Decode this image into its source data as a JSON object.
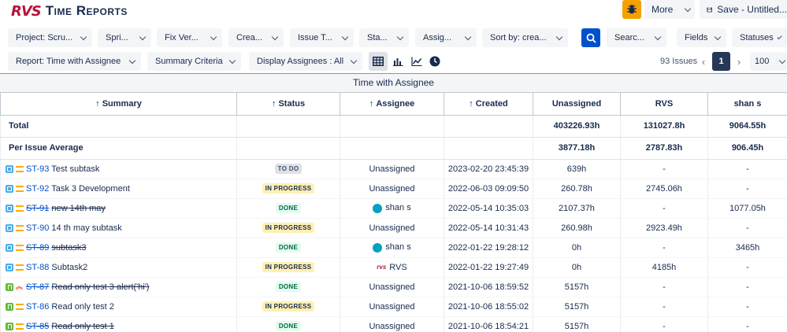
{
  "app": {
    "logo_mark": "RVS",
    "title": "Time Reports"
  },
  "header": {
    "more_label": "More",
    "save_label": "Save - Untitled...",
    "bug_icon": "bug-icon"
  },
  "filters_row1": {
    "project": "Project: Scru...",
    "sprint": "Spri...",
    "fix_version": "Fix Ver...",
    "created": "Crea...",
    "issue_type": "Issue T...",
    "status": "Sta...",
    "assignee": "Assig...",
    "sort_by": "Sort by: crea...",
    "search": "Searc...",
    "fields": "Fields",
    "statuses": "Statuses"
  },
  "filters_row2": {
    "report": "Report: Time with Assignee",
    "summary_criteria": "Summary Criteria",
    "display_assignees": "Display Assignees : All"
  },
  "pagination": {
    "issues_count": "93 Issues",
    "prev": "‹",
    "current_page": "1",
    "next": "›",
    "page_size": "100"
  },
  "report": {
    "title": "Time with Assignee",
    "columns": [
      "Summary",
      "Status",
      "Assignee",
      "Created",
      "Unassigned",
      "RVS",
      "shan s"
    ],
    "total": {
      "label": "Total",
      "unassigned": "403226.93h",
      "rvs": "131027.8h",
      "shan": "9064.55h"
    },
    "average": {
      "label": "Per Issue Average",
      "unassigned": "3877.18h",
      "rvs": "2787.83h",
      "shan": "906.45h"
    },
    "rows": [
      {
        "key": "ST-93",
        "summary": "Test subtask",
        "status": "TO DO",
        "assignee": "Unassigned",
        "created": "2023-02-20 23:45:39",
        "unassigned": "639h",
        "rvs": "-",
        "shan": "-"
      },
      {
        "key": "ST-92",
        "summary": "Task 3 Development",
        "status": "IN PROGRESS",
        "assignee": "Unassigned",
        "created": "2022-06-03 09:09:50",
        "unassigned": "260.78h",
        "rvs": "2745.06h",
        "shan": "-"
      },
      {
        "key": "ST-91",
        "summary": "new 14th may",
        "status": "DONE",
        "assignee": "shan s",
        "created": "2022-05-14 10:35:03",
        "unassigned": "2107.37h",
        "rvs": "-",
        "shan": "1077.05h"
      },
      {
        "key": "ST-90",
        "summary": "14 th may subtask",
        "status": "IN PROGRESS",
        "assignee": "Unassigned",
        "created": "2022-05-14 10:31:43",
        "unassigned": "260.98h",
        "rvs": "2923.49h",
        "shan": "-"
      },
      {
        "key": "ST-89",
        "summary": "subtask3",
        "status": "DONE",
        "assignee": "shan s",
        "created": "2022-01-22 19:28:12",
        "unassigned": "0h",
        "rvs": "-",
        "shan": "3465h"
      },
      {
        "key": "ST-88",
        "summary": "Subtask2",
        "status": "IN PROGRESS",
        "assignee": "RVS",
        "created": "2022-01-22 19:27:49",
        "unassigned": "0h",
        "rvs": "4185h",
        "shan": "-"
      },
      {
        "key": "ST-87",
        "summary": "Read only test 3 alert('hi')",
        "status": "DONE",
        "assignee": "Unassigned",
        "created": "2021-10-06 18:59:52",
        "unassigned": "5157h",
        "rvs": "-",
        "shan": "-"
      },
      {
        "key": "ST-86",
        "summary": "Read only test 2",
        "status": "IN PROGRESS",
        "assignee": "Unassigned",
        "created": "2021-10-06 18:55:02",
        "unassigned": "5157h",
        "rvs": "-",
        "shan": "-"
      },
      {
        "key": "ST-85",
        "summary": "Read only test 1",
        "status": "DONE",
        "assignee": "Unassigned",
        "created": "2021-10-06 18:54:21",
        "unassigned": "5157h",
        "rvs": "-",
        "shan": "-"
      }
    ]
  },
  "colors": {
    "brand": "#b8143c",
    "accent": "#0052cc",
    "bug_button": "#f4a100"
  }
}
